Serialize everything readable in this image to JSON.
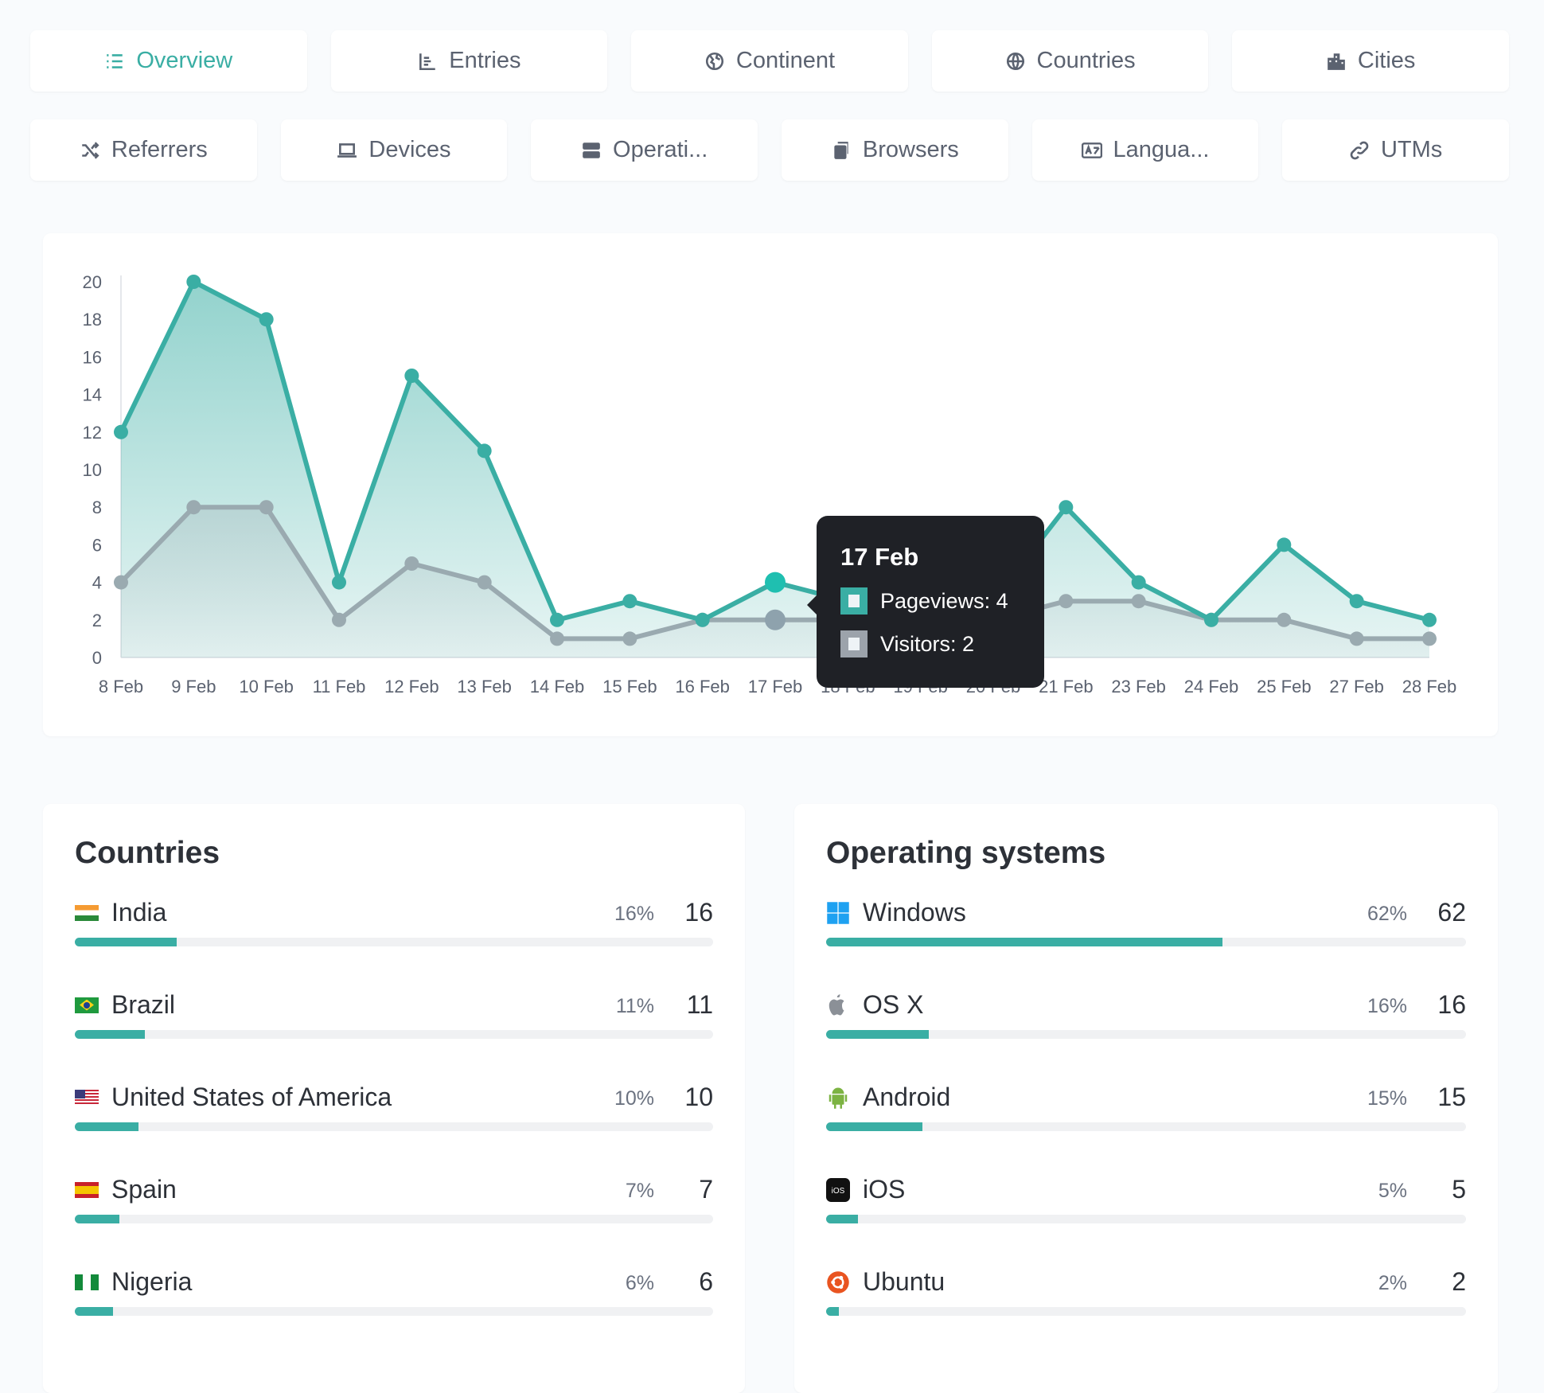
{
  "tabs_row1": [
    {
      "label": "Overview",
      "icon": "list-icon",
      "active": true
    },
    {
      "label": "Entries",
      "icon": "bar-chart-icon"
    },
    {
      "label": "Continent",
      "icon": "globe-europe-icon"
    },
    {
      "label": "Countries",
      "icon": "globe-icon"
    },
    {
      "label": "Cities",
      "icon": "city-icon"
    }
  ],
  "tabs_row2": [
    {
      "label": "Referrers",
      "icon": "shuffle-icon"
    },
    {
      "label": "Devices",
      "icon": "laptop-icon"
    },
    {
      "label": "Operati...",
      "icon": "server-icon"
    },
    {
      "label": "Browsers",
      "icon": "window-icon"
    },
    {
      "label": "Langua...",
      "icon": "language-icon"
    },
    {
      "label": "UTMs",
      "icon": "link-icon"
    }
  ],
  "chart_data": {
    "type": "area",
    "categories": [
      "8 Feb",
      "9 Feb",
      "10 Feb",
      "11 Feb",
      "12 Feb",
      "13 Feb",
      "14 Feb",
      "15 Feb",
      "16 Feb",
      "17 Feb",
      "18 Feb",
      "19 Feb",
      "20 Feb",
      "21 Feb",
      "23 Feb",
      "24 Feb",
      "25 Feb",
      "27 Feb",
      "28 Feb"
    ],
    "series": [
      {
        "name": "Pageviews",
        "color": "#3aaea4",
        "values": [
          12,
          20,
          18,
          4,
          15,
          11,
          2,
          3,
          2,
          4,
          3,
          2,
          3,
          8,
          4,
          2,
          6,
          3,
          2
        ]
      },
      {
        "name": "Visitors",
        "color": "#9aaab0",
        "values": [
          4,
          8,
          8,
          2,
          5,
          4,
          1,
          1,
          2,
          2,
          2,
          2,
          2,
          3,
          3,
          2,
          2,
          1,
          1
        ]
      }
    ],
    "ylim": [
      0,
      20
    ],
    "yticks": [
      0,
      2,
      4,
      6,
      8,
      10,
      12,
      14,
      16,
      18,
      20
    ],
    "grid": false
  },
  "tooltip": {
    "title": "17 Feb",
    "pageviews": "Pageviews: 4",
    "visitors": "Visitors: 2"
  },
  "countries": {
    "title": "Countries",
    "items": [
      {
        "name": "India",
        "pct": "16%",
        "count": "16",
        "fill": 16,
        "flag": "india"
      },
      {
        "name": "Brazil",
        "pct": "11%",
        "count": "11",
        "fill": 11,
        "flag": "brazil"
      },
      {
        "name": "United States of America",
        "pct": "10%",
        "count": "10",
        "fill": 10,
        "flag": "usa"
      },
      {
        "name": "Spain",
        "pct": "7%",
        "count": "7",
        "fill": 7,
        "flag": "spain"
      },
      {
        "name": "Nigeria",
        "pct": "6%",
        "count": "6",
        "fill": 6,
        "flag": "nigeria"
      }
    ]
  },
  "os": {
    "title": "Operating systems",
    "items": [
      {
        "name": "Windows",
        "pct": "62%",
        "count": "62",
        "fill": 62,
        "icon": "windows-icon"
      },
      {
        "name": "OS X",
        "pct": "16%",
        "count": "16",
        "fill": 16,
        "icon": "apple-icon"
      },
      {
        "name": "Android",
        "pct": "15%",
        "count": "15",
        "fill": 15,
        "icon": "android-icon"
      },
      {
        "name": "iOS",
        "pct": "5%",
        "count": "5",
        "fill": 5,
        "icon": "ios-icon"
      },
      {
        "name": "Ubuntu",
        "pct": "2%",
        "count": "2",
        "fill": 2,
        "icon": "ubuntu-icon"
      }
    ]
  }
}
